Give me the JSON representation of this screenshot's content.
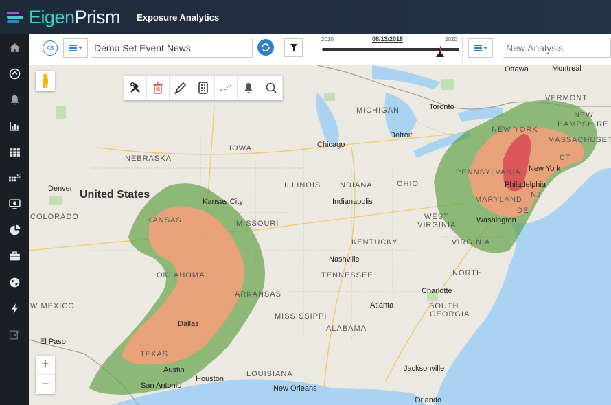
{
  "app": {
    "logo_prefix": "Eigen",
    "logo_suffix": "Prism",
    "title": "Exposure Analytics"
  },
  "toolbar": {
    "badge": "AB",
    "event_value": "Demo Set Event News",
    "analysis_placeholder": "New Analysis",
    "timeline": {
      "min_label": "2010",
      "max_label": "2020",
      "current_date": "08/13/2018",
      "position": 0.86
    }
  },
  "sidebar": {
    "items": [
      {
        "icon": "home-icon"
      },
      {
        "icon": "globe-sync-icon"
      },
      {
        "icon": "bell-icon"
      },
      {
        "icon": "bar-chart-icon"
      },
      {
        "icon": "grid-icon"
      },
      {
        "icon": "dollar-grid-icon"
      },
      {
        "icon": "monitor-icon"
      },
      {
        "icon": "pie-chart-icon"
      },
      {
        "icon": "briefcase-icon"
      },
      {
        "icon": "globe-icon"
      },
      {
        "icon": "lightning-icon"
      },
      {
        "icon": "edit-icon"
      }
    ]
  },
  "map": {
    "country": "United States",
    "states": [
      "NEBRASKA",
      "IOWA",
      "ILLINOIS",
      "INDIANA",
      "OHIO",
      "KANSAS",
      "MISSOURI",
      "KENTUCKY",
      "OKLAHOMA",
      "ARKANSAS",
      "TENNESSEE",
      "TEXAS",
      "LOUISIANA",
      "MISSISSIPPI",
      "ALABAMA",
      "GEORGIA",
      "SOUTH",
      "NORTH",
      "COLORADO",
      "W MEXICO",
      "MICHIGAN",
      "NEW YORK",
      "PENNSYLVANIA",
      "WEST",
      "VIRGINIA",
      "VIRGINIA",
      "MARYLAND",
      "VERMONT",
      "NEW",
      "HAMPSHIRE",
      "MASSACHUSETTS",
      "CT",
      "NJ",
      "DE"
    ],
    "cities": [
      "Denver",
      "Kansas City",
      "Chicago",
      "Indianapolis",
      "Nashville",
      "Dallas",
      "Austin",
      "Houston",
      "San Antonio",
      "El Paso",
      "New Orleans",
      "Atlanta",
      "Charlotte",
      "Jacksonville",
      "Orlando",
      "Washington",
      "Philadelphia",
      "New York",
      "Toronto",
      "Detroit",
      "Ottawa",
      "Montreal"
    ],
    "zoom_in": "+",
    "zoom_out": "−"
  },
  "colors": {
    "zone_low": "#5a9e3e",
    "zone_mid": "#f2a07a",
    "zone_high": "#d94a55",
    "accent": "#2e80c8"
  }
}
